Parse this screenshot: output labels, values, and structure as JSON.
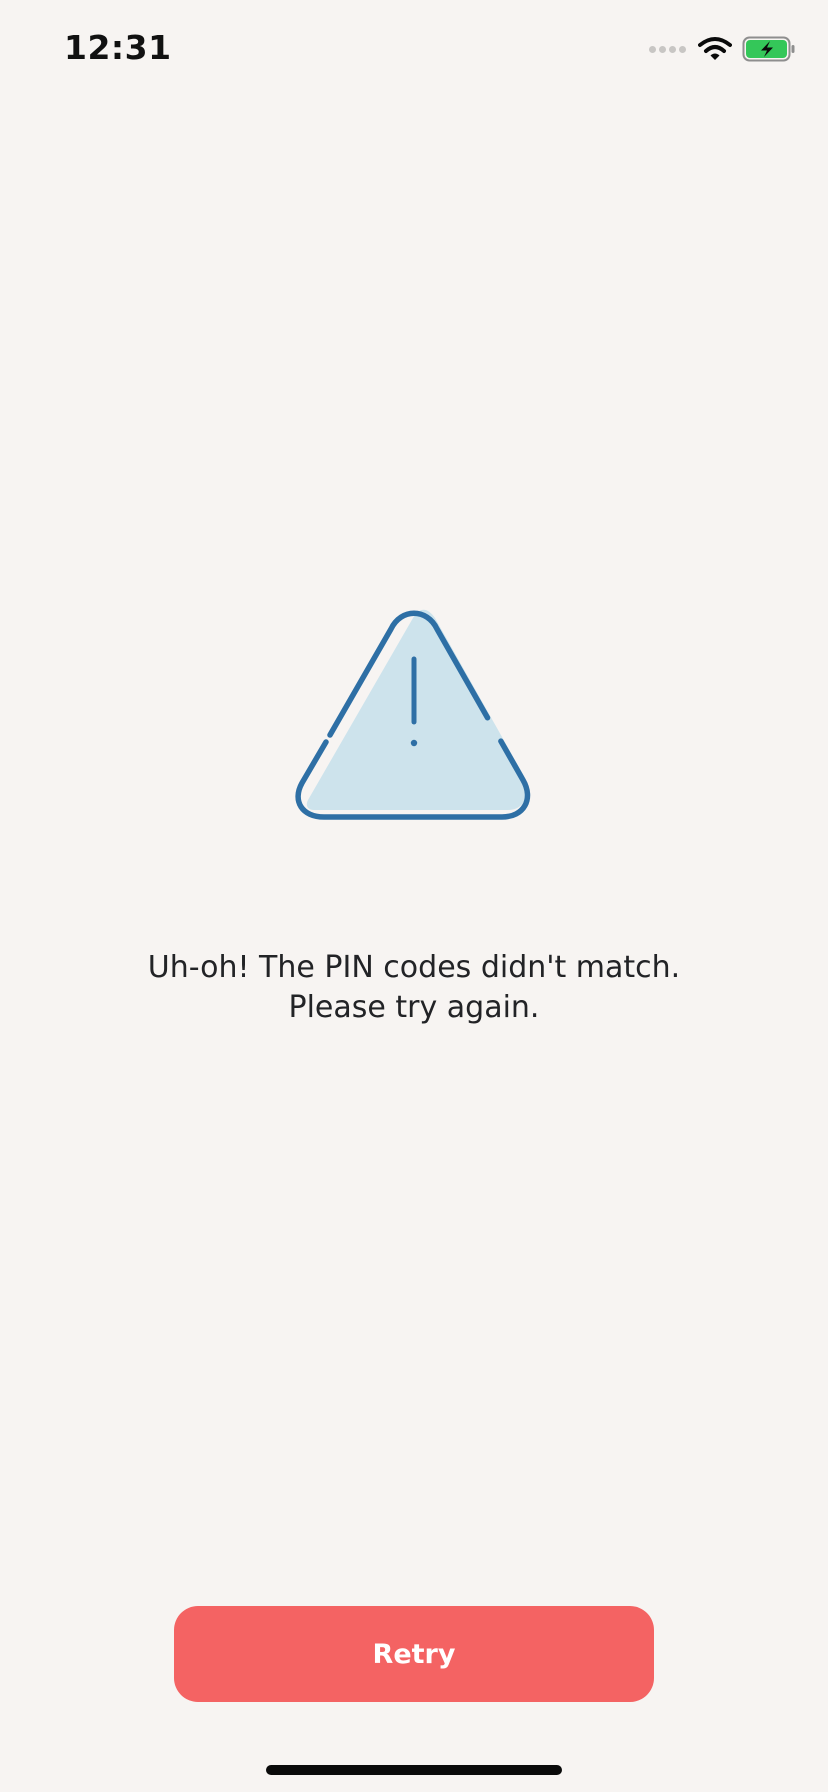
{
  "status_bar": {
    "time": "12:31",
    "signal_icon": "cellular-signal-icon",
    "wifi_icon": "wifi-icon",
    "battery_icon": "battery-charging-icon",
    "battery_color": "#34c759"
  },
  "main": {
    "icon": "warning-triangle-icon",
    "icon_stroke_color": "#2e6fa5",
    "icon_fill_color": "#cde3ec",
    "message": "Uh-oh! The PIN codes didn't match. Please try again."
  },
  "actions": {
    "retry_label": "Retry",
    "retry_color": "#f46363"
  }
}
